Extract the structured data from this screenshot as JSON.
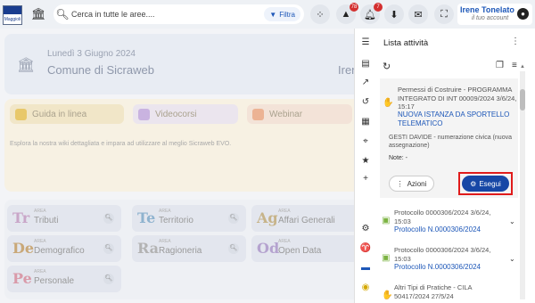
{
  "logo": {
    "text": "Maggioli"
  },
  "search": {
    "placeholder": "Cerca in tutte le aree....",
    "filter_label": "Filtra"
  },
  "topbar": {
    "badges": {
      "alerts": "78",
      "notifications": "7"
    }
  },
  "user": {
    "name": "Irene Tonelato",
    "status": "il tuo account"
  },
  "hero": {
    "date": "Lunedì 3 Giugno 2024",
    "entity": "Comune di Sicraweb",
    "user_short": "Irene"
  },
  "help": {
    "buttons": [
      "Guida in linea",
      "Videocorsi",
      "Webinar"
    ],
    "description": "Esplora la nostra wiki dettagliata e impara ad utilizzare al meglio Sicraweb EVO."
  },
  "areas": {
    "area_label": "AREA",
    "items": [
      {
        "abbr": "Tr",
        "name": "Tributi",
        "color": "#c9a6c8"
      },
      {
        "abbr": "Te",
        "name": "Territorio",
        "color": "#8fb3cf"
      },
      {
        "abbr": "Ag",
        "name": "Affari Generali",
        "color": "#c7b48a"
      },
      {
        "abbr": "De",
        "name": "Demografico",
        "color": "#c9a878"
      },
      {
        "abbr": "Ra",
        "name": "Ragioneria",
        "color": "#b3b3b3"
      },
      {
        "abbr": "Od",
        "name": "Open Data",
        "color": "#b5a3cf"
      },
      {
        "abbr": "Pe",
        "name": "Personale",
        "color": "#d99aa9"
      }
    ]
  },
  "panel": {
    "title": "Lista attività",
    "task1": {
      "category": "Permessi di Costruire - PROGRAMMA INTEGRATO DI INT  00009/2024  3/6/24, 15:17",
      "title": "NUOVA ISTANZA DA SPORTELLO TELEMATICO",
      "note1": "GESTI DAVIDE - numerazione civica (nuova assegnazione)",
      "note2": "Note:  -",
      "actions_label": "Azioni",
      "execute_label": "Esegui"
    },
    "tasks": [
      {
        "category": "Protocollo  0000306/2024  3/6/24, 15:03",
        "title": "Protocollo N.0000306/2024"
      },
      {
        "category": "Protocollo  0000306/2024  3/6/24, 15:03",
        "title": "Protocollo N.0000306/2024"
      },
      {
        "category": "Altri Tipi di Pratiche - CILA  50417/2024  27/5/24",
        "title": ""
      }
    ]
  }
}
